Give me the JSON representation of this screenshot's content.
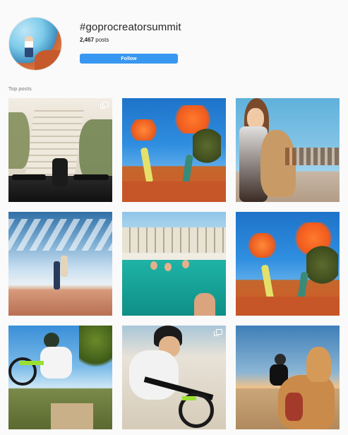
{
  "profile": {
    "hashtag": "#goprocreatorsummit",
    "post_count": "2,467",
    "post_count_label": "posts",
    "follow_label": "Follow"
  },
  "top_posts": {
    "label": "Top posts",
    "posts": [
      {
        "description": "bike on stairs",
        "icon": "multiple-photos-icon"
      },
      {
        "description": "orange powder throw"
      },
      {
        "description": "camel selfie"
      },
      {
        "description": "beach lift"
      },
      {
        "description": "pool group"
      },
      {
        "description": "orange powder throw"
      },
      {
        "description": "bike wheelie"
      },
      {
        "description": "bike selfie",
        "icon": "multiple-photos-icon"
      },
      {
        "description": "camel beach"
      }
    ]
  },
  "colors": {
    "follow_button": "#3897f0",
    "background": "#fafafa"
  }
}
